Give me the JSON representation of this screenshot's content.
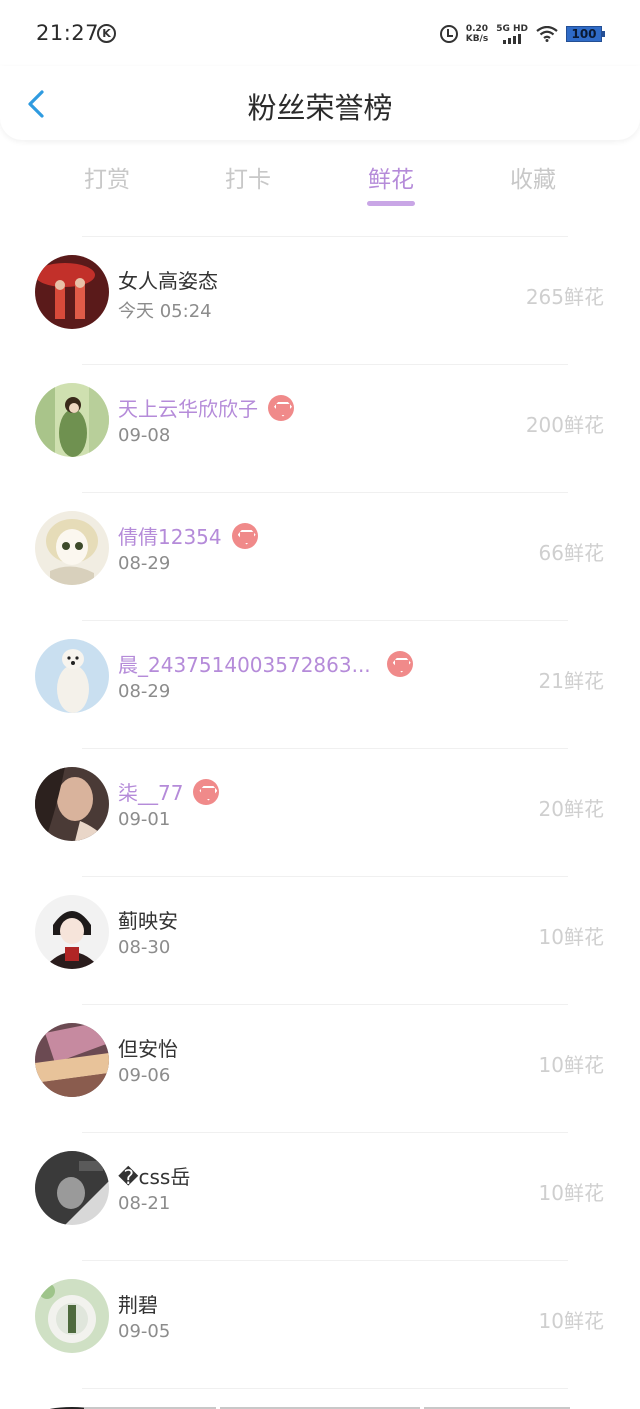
{
  "status_bar": {
    "time": "21:27",
    "k_badge": "K",
    "net_speed_value": "0.20",
    "net_speed_unit": "KB/s",
    "signal_label": "5G HD",
    "battery": "100"
  },
  "header": {
    "title": "粉丝荣誉榜"
  },
  "tabs": [
    {
      "label": "打赏",
      "active": false
    },
    {
      "label": "打卡",
      "active": false
    },
    {
      "label": "鲜花",
      "active": true
    },
    {
      "label": "收藏",
      "active": false
    }
  ],
  "rows": [
    {
      "name": "女人高姿态",
      "date": "今天 05:24",
      "score": "265鲜花",
      "vip": false
    },
    {
      "name": "天上云华欣欣子",
      "date": "09-08",
      "score": "200鲜花",
      "vip": true
    },
    {
      "name": "倩倩12354",
      "date": "08-29",
      "score": "66鲜花",
      "vip": true
    },
    {
      "name": "晨_2437514003572863...",
      "date": "08-29",
      "score": "21鲜花",
      "vip": true
    },
    {
      "name": "柒__77",
      "date": "09-01",
      "score": "20鲜花",
      "vip": true
    },
    {
      "name": "蓟映安",
      "date": "08-30",
      "score": "10鲜花",
      "vip": false
    },
    {
      "name": "但安怡",
      "date": "09-06",
      "score": "10鲜花",
      "vip": false
    },
    {
      "name": "�css岳",
      "date": "08-21",
      "score": "10鲜花",
      "vip": false
    },
    {
      "name": "荆碧",
      "date": "09-05",
      "score": "10鲜花",
      "vip": false
    }
  ],
  "colors": {
    "accent": "#b58bd9",
    "vip_badge": "#f08a8a",
    "back_arrow": "#2f9be0"
  }
}
